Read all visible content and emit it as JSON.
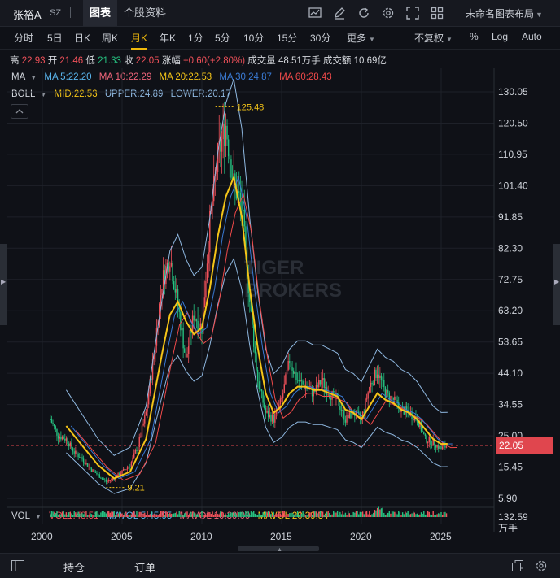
{
  "header": {
    "stock_name": "张裕A",
    "exchange": "SZ",
    "tabs": [
      {
        "label": "图表",
        "active": true
      },
      {
        "label": "个股资料",
        "active": false
      }
    ],
    "toolbar_icons": [
      "line-chart-icon",
      "draw-pen-icon",
      "refresh-icon",
      "settings-gear-icon",
      "fullscreen-icon",
      "grid-layout-icon"
    ],
    "layout_label": "未命名图表布局"
  },
  "periods": [
    {
      "label": "分时",
      "active": false
    },
    {
      "label": "5日",
      "active": false
    },
    {
      "label": "日K",
      "active": false
    },
    {
      "label": "周K",
      "active": false
    },
    {
      "label": "月K",
      "active": true
    },
    {
      "label": "年K",
      "active": false
    },
    {
      "label": "1分",
      "active": false
    },
    {
      "label": "5分",
      "active": false
    },
    {
      "label": "10分",
      "active": false
    },
    {
      "label": "15分",
      "active": false
    },
    {
      "label": "30分",
      "active": false
    },
    {
      "label": "更多",
      "active": false,
      "dropdown": true
    }
  ],
  "right_options": [
    {
      "label": "不复权",
      "dropdown": true
    },
    {
      "label": "%"
    },
    {
      "label": "Log"
    },
    {
      "label": "Auto"
    }
  ],
  "quote": {
    "high_label": "高",
    "high": "22.93",
    "open_label": "开",
    "open": "21.46",
    "low_label": "低",
    "low": "21.33",
    "close_label": "收",
    "close": "22.05",
    "change_label": "涨幅",
    "change": "+0.60(+2.80%)",
    "volume_label": "成交量",
    "volume": "48.51万手",
    "amount_label": "成交额",
    "amount": "10.69亿"
  },
  "ma_line": {
    "name": "MA",
    "items": [
      {
        "text": "MA 5:22.20",
        "color": "#5ab7f0"
      },
      {
        "text": "MA 10:22.29",
        "color": "#f0657a"
      },
      {
        "text": "MA 20:22.53",
        "color": "#f5c518"
      },
      {
        "text": "MA 30:24.87",
        "color": "#3a7bd5"
      },
      {
        "text": "MA 60:28.43",
        "color": "#f04a4a"
      }
    ]
  },
  "boll_line": {
    "name": "BOLL",
    "items": [
      {
        "text": "MID:22.53",
        "color": "#f5c518"
      },
      {
        "text": "UPPER:24.89",
        "color": "#8fb8e0"
      },
      {
        "text": "LOWER:20.17",
        "color": "#8fb8e0"
      }
    ]
  },
  "vol_line": {
    "name": "VOL",
    "items": [
      {
        "text": "VOL1:48.51",
        "color": "#f0515a"
      },
      {
        "text": "MAVOL 5:45.95",
        "color": "#5ab7f0"
      },
      {
        "text": "MAVOL 10:39.09",
        "color": "#f0657a"
      },
      {
        "text": "MAVOL 20:39.34",
        "color": "#f5c518"
      }
    ]
  },
  "price_axis": [
    "130.05",
    "120.50",
    "110.95",
    "101.40",
    "91.85",
    "82.30",
    "72.75",
    "63.20",
    "53.65",
    "44.10",
    "34.55",
    "25.00",
    "15.45",
    "5.90"
  ],
  "current_price": "22.05",
  "vol_axis": {
    "max": "132.59",
    "unit": "万手"
  },
  "x_axis": [
    "2000",
    "2005",
    "2010",
    "2015",
    "2020",
    "2025"
  ],
  "annotations": {
    "high_mark": "125.48",
    "low_mark": "9.21"
  },
  "watermark": [
    "TIGER",
    "BROKERS"
  ],
  "bottom": {
    "positions": "持仓",
    "orders": "订单"
  },
  "colors": {
    "up": "#f0515a",
    "down": "#26c281",
    "accent": "#f0b90b",
    "bg": "#0f1117"
  },
  "chart_data": {
    "type": "candlestick-monthly",
    "ylim": [
      5.9,
      130.05
    ],
    "x_range": [
      1999.5,
      2025.8
    ],
    "close_series": [
      [
        2000.5,
        30
      ],
      [
        2001.0,
        25
      ],
      [
        2001.5,
        24
      ],
      [
        2002.0,
        20
      ],
      [
        2002.5,
        18
      ],
      [
        2003.0,
        15
      ],
      [
        2003.5,
        13
      ],
      [
        2004.0,
        11
      ],
      [
        2004.5,
        12
      ],
      [
        2005.0,
        14
      ],
      [
        2005.5,
        16
      ],
      [
        2006.0,
        22
      ],
      [
        2006.5,
        32
      ],
      [
        2007.0,
        50
      ],
      [
        2007.5,
        72
      ],
      [
        2008.0,
        80
      ],
      [
        2008.5,
        65
      ],
      [
        2009.0,
        48
      ],
      [
        2009.5,
        62
      ],
      [
        2010.0,
        58
      ],
      [
        2010.5,
        90
      ],
      [
        2011.0,
        110
      ],
      [
        2011.5,
        120
      ],
      [
        2012.0,
        102
      ],
      [
        2012.5,
        95
      ],
      [
        2013.0,
        66
      ],
      [
        2013.5,
        42
      ],
      [
        2014.0,
        32
      ],
      [
        2014.5,
        30
      ],
      [
        2015.0,
        36
      ],
      [
        2015.5,
        48
      ],
      [
        2016.0,
        42
      ],
      [
        2016.5,
        40
      ],
      [
        2017.0,
        38
      ],
      [
        2017.5,
        42
      ],
      [
        2018.0,
        38
      ],
      [
        2018.5,
        36
      ],
      [
        2019.0,
        30
      ],
      [
        2019.5,
        32
      ],
      [
        2020.0,
        30
      ],
      [
        2020.5,
        40
      ],
      [
        2021.0,
        45
      ],
      [
        2021.5,
        38
      ],
      [
        2022.0,
        36
      ],
      [
        2022.5,
        33
      ],
      [
        2023.0,
        32
      ],
      [
        2023.5,
        30
      ],
      [
        2024.0,
        24
      ],
      [
        2024.5,
        23
      ],
      [
        2025.0,
        21
      ],
      [
        2025.4,
        22.05
      ]
    ],
    "ma20_series": [
      [
        2001.5,
        28
      ],
      [
        2002.5,
        22
      ],
      [
        2003.5,
        16
      ],
      [
        2004.5,
        12
      ],
      [
        2005.5,
        14
      ],
      [
        2006.5,
        24
      ],
      [
        2007.5,
        50
      ],
      [
        2008.0,
        62
      ],
      [
        2008.5,
        66
      ],
      [
        2009.0,
        60
      ],
      [
        2009.5,
        56
      ],
      [
        2010.0,
        58
      ],
      [
        2010.5,
        70
      ],
      [
        2011.0,
        86
      ],
      [
        2011.5,
        98
      ],
      [
        2012.0,
        104
      ],
      [
        2012.5,
        92
      ],
      [
        2013.0,
        70
      ],
      [
        2013.5,
        52
      ],
      [
        2014.0,
        38
      ],
      [
        2014.5,
        32
      ],
      [
        2015.0,
        34
      ],
      [
        2015.5,
        38
      ],
      [
        2016.0,
        40
      ],
      [
        2016.5,
        40
      ],
      [
        2017.0,
        39
      ],
      [
        2017.5,
        39
      ],
      [
        2018.0,
        38
      ],
      [
        2018.5,
        37
      ],
      [
        2019.0,
        33
      ],
      [
        2019.5,
        32
      ],
      [
        2020.0,
        30
      ],
      [
        2020.5,
        34
      ],
      [
        2021.0,
        38
      ],
      [
        2021.5,
        36
      ],
      [
        2022.0,
        35
      ],
      [
        2022.5,
        33
      ],
      [
        2023.0,
        32
      ],
      [
        2023.5,
        30
      ],
      [
        2024.0,
        27
      ],
      [
        2024.5,
        24
      ],
      [
        2025.0,
        22.5
      ],
      [
        2025.4,
        22.53
      ]
    ]
  }
}
